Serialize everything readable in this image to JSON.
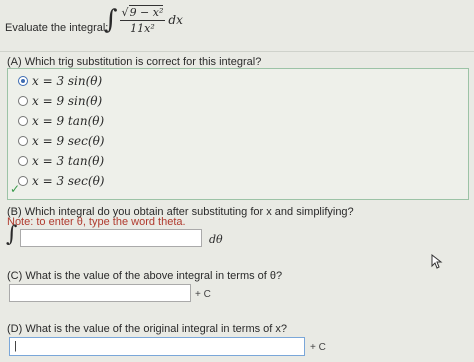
{
  "question": {
    "prompt": "Evaluate the integral:",
    "integral_sign": "∫",
    "numerator": "9 − x²",
    "sqrt_symbol": "√",
    "denominator": "11x²",
    "differential": "dx"
  },
  "partA": {
    "label": "(A) Which trig substitution is correct for this integral?",
    "options": [
      {
        "text": "x = 3 sin(θ)",
        "selected": true
      },
      {
        "text": "x = 9 sin(θ)",
        "selected": false
      },
      {
        "text": "x = 9 tan(θ)",
        "selected": false
      },
      {
        "text": "x = 9 sec(θ)",
        "selected": false
      },
      {
        "text": "x = 3 tan(θ)",
        "selected": false
      },
      {
        "text": "x = 3 sec(θ)",
        "selected": false
      }
    ],
    "check_mark": "✓"
  },
  "partB": {
    "label": "(B) Which integral do you obtain after substituting for x and simplifying?",
    "note": "Note: to enter θ, type the word theta.",
    "integral_sign": "∫",
    "input_value": "",
    "suffix": "dθ"
  },
  "partC": {
    "label": "(C) What is the value of the above integral in terms of θ?",
    "input_value": "",
    "suffix": "+ C"
  },
  "partD": {
    "label": "(D) What is the value of the original integral in terms of x?",
    "input_value": "|",
    "suffix": "+ C"
  },
  "colors": {
    "background": "#e9eae4",
    "panel_border": "#9cc3a6",
    "note_red": "#b03a2e",
    "check_green": "#3a9a4a",
    "radio_blue": "#3f6db3"
  }
}
